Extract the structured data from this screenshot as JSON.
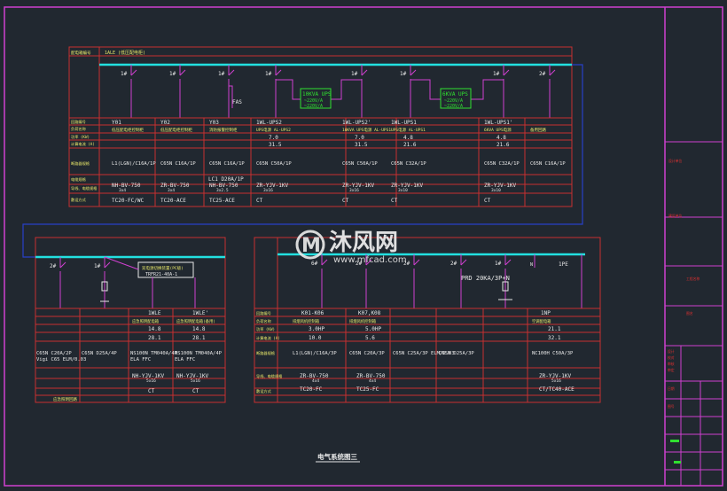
{
  "title": "电气系统图三",
  "watermark": {
    "brand": "沐风网",
    "url": "www.mfcad.com"
  },
  "top_panel": {
    "header_label": "配电箱编号",
    "header_value": "1ALE (低压配电柜)",
    "row_labels": [
      "回路编号",
      "负荷名称",
      "功率 (KW)",
      "计算电流 (A)",
      "断路器规格",
      "电缆规格",
      "导线、电缆规格",
      "敷设方式"
    ],
    "breaker_tags": [
      "1#",
      "1#",
      "1#",
      "1#",
      "1#",
      "1#",
      "1#",
      "2#"
    ],
    "fas_label": "FAS",
    "ups_box_1": [
      "10KVA UPS",
      "~220V/A",
      "~220V/A"
    ],
    "ups_box_2": [
      "6KVA UPS",
      "~220V/A",
      "~220V/A"
    ],
    "columns": [
      {
        "code": "Y01",
        "name": "低压配电柜控制柜",
        "kw": "",
        "amp": "",
        "cb": "L1(LGN)/C16A/1P",
        "cable": "NH-BV-750",
        "wire": "3x4",
        "lay": "TC20-FC/WC"
      },
      {
        "code": "Y02",
        "name": "低压配电柜控制柜",
        "kw": "",
        "amp": "",
        "cb": "C65N C16A/1P",
        "cable": "ZR-BV-750",
        "wire": "3x4",
        "lay": "TC20-ACE"
      },
      {
        "code": "Y03",
        "name": "消防报警控制柜",
        "kw": "",
        "amp": "",
        "cb": "C65N C16A/1P",
        "cable": "NH-BV-750",
        "wire": "3x2.5",
        "lay": "TC25-ACE"
      },
      {
        "code": "1WL-UPS2",
        "name": "UPS电源 AL-UPS2",
        "kw": "7.0",
        "amp": "31.5",
        "cb": "C65N C50A/1P",
        "cable": "ZR-YJV-1KV",
        "wire": "3x16",
        "lay": "CT"
      },
      {
        "code": "1WL-UPS2'",
        "name": "10KVA UPS电源 AL-UPS1",
        "kw": "7.0",
        "amp": "31.5",
        "cb": "C65N C50A/1P",
        "cable": "ZR-YJV-1KV",
        "wire": "3x16",
        "lay": "CT"
      },
      {
        "code": "1WL-UPS1",
        "name": "UPS电源 AL-UPS1",
        "kw": "4.8",
        "amp": "21.6",
        "cb": "C65N C32A/1P",
        "cable": "ZR-YJV-1KV",
        "wire": "3x10",
        "lay": "CT"
      },
      {
        "code": "1WL-UPS1'",
        "name": "6KVA UPS电源",
        "kw": "4.8",
        "amp": "21.6",
        "cb": "C65N C32A/1P",
        "cable": "ZR-YJV-1KV",
        "wire": "3x10",
        "lay": "CT"
      },
      {
        "code": "",
        "name": "备用回路",
        "kw": "",
        "amp": "",
        "cb": "C65N C16A/1P",
        "cable": "",
        "wire": "",
        "lay": ""
      }
    ],
    "extra_cb": "LC1 D20A/1P"
  },
  "left_panel": {
    "tags": [
      "2#",
      "1#"
    ],
    "device_box": [
      "双电源切换装置(PC级)",
      "TRFR21-40A-1"
    ],
    "columns": [
      {
        "code": "",
        "name": "",
        "kw": "",
        "amp": "",
        "cb": "C65N C20A/2P Vigi C65 ELM/0.03"
      },
      {
        "code": "",
        "name": "",
        "kw": "",
        "amp": "",
        "cb": "C65N D25A/4P"
      },
      {
        "code": "1WLE",
        "name": "应急照明配电箱",
        "kw": "14.8",
        "amp": "28.1",
        "cb": "NS100N TM040A/4P ELA FFC",
        "cable": "NH-YJV-1KV",
        "wire": "5x16",
        "lay": "CT"
      },
      {
        "code": "1WLE'",
        "name": "应急照明配电箱(备用)",
        "kw": "14.8",
        "amp": "28.1",
        "cb": "NS100N TM040A/4P ELA FFC",
        "cable": "NH-YJV-1KV",
        "wire": "5x16",
        "lay": "CT"
      }
    ],
    "footer_label": "应急照明回路"
  },
  "right_panel": {
    "row_labels": [
      "回路编号",
      "负荷名称",
      "功率 (KW)",
      "计算电流 (A)",
      "断路器规格",
      "导线、电缆规格",
      "敷设方式"
    ],
    "tags": [
      "6#",
      "2#",
      "2#",
      "2#",
      "1#",
      "1PE"
    ],
    "prd": "PRD 20KA/3P+N",
    "columns": [
      {
        "code": "K01-K06",
        "name": "排烟风机控制箱",
        "kw": "3.0HP",
        "amp": "10.0",
        "cb": "L1(LGN)/C16A/3P",
        "cable": "ZR-BV-750",
        "wire": "4x4",
        "lay": "TC20-FC"
      },
      {
        "code": "K07,K08",
        "name": "排烟风机控制箱",
        "kw": "5.0HP",
        "amp": "5.6",
        "cb": "C65N C20A/3P",
        "cable": "ZR-BV-750",
        "wire": "4x4",
        "lay": "TC25-FC"
      },
      {
        "code": "",
        "name": "",
        "kw": "",
        "amp": "",
        "cb": "C65N C25A/3P ELM/0.03",
        "cable": "",
        "wire": "",
        "lay": ""
      },
      {
        "code": "",
        "name": "",
        "kw": "",
        "amp": "",
        "cb": "C65N D25A/3P",
        "cable": "",
        "wire": "",
        "lay": ""
      },
      {
        "code": "1NP",
        "name": "空调配电箱",
        "kw": "21.1",
        "amp": "32.1",
        "cb": "NC100H C50A/3P",
        "cable": "ZR-YJV-1KV",
        "wire": "5x16",
        "lay": "CT/TC40-ACE"
      }
    ]
  },
  "title_block": {
    "labels": [
      "设计单位",
      "建设单位",
      "工程名称",
      "图名",
      "设计",
      "校对",
      "审核",
      "审定",
      "日期",
      "图号"
    ]
  }
}
